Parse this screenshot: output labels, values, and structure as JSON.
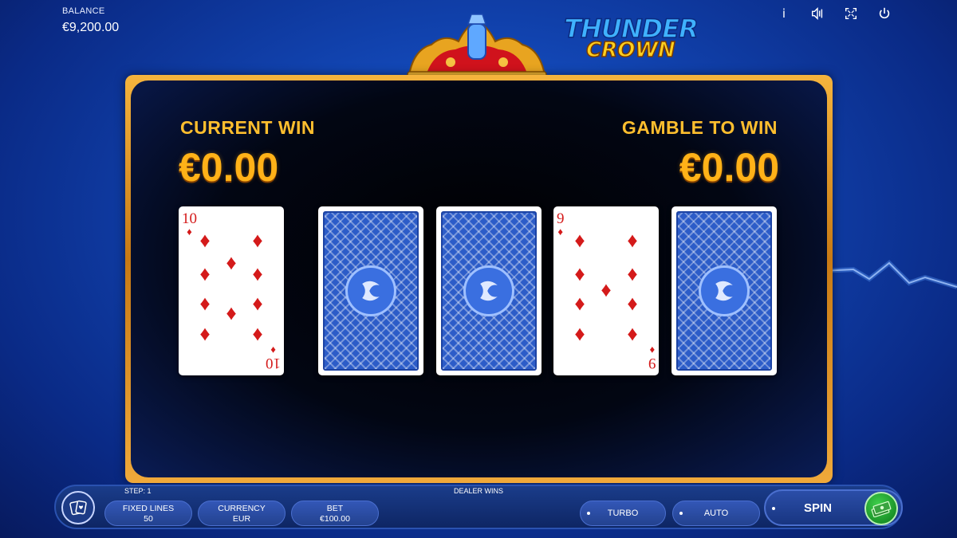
{
  "balance": {
    "label": "BALANCE",
    "value": "€9,200.00"
  },
  "top_icons": [
    "info-icon",
    "sound-icon",
    "fullscreen-icon",
    "power-icon"
  ],
  "info_glyph": "i",
  "logo": {
    "line1": "THUNDER",
    "line2": "CROWN"
  },
  "gamble": {
    "current_win_label": "CURRENT WIN",
    "current_win_value": "€0.00",
    "gamble_to_win_label": "GAMBLE TO WIN",
    "gamble_to_win_value": "€0.00",
    "cards": [
      {
        "rank": "10",
        "suit": "♦",
        "face": "up"
      },
      {
        "face": "down"
      },
      {
        "face": "down"
      },
      {
        "rank": "9",
        "suit": "♦",
        "face": "up"
      },
      {
        "face": "down"
      }
    ]
  },
  "status": {
    "step": "STEP: 1",
    "message": "DEALER WINS"
  },
  "controls": {
    "fixed_lines_label": "FIXED LINES",
    "fixed_lines_value": "50",
    "currency_label": "CURRENCY",
    "currency_value": "EUR",
    "bet_label": "BET",
    "bet_value": "€100.00",
    "turbo_label": "TURBO",
    "auto_label": "AUTO",
    "spin_label": "SPIN"
  },
  "colors": {
    "accent_gold": "#ffb218",
    "card_red": "#d41a1a",
    "spin_green": "#1fa52e"
  }
}
